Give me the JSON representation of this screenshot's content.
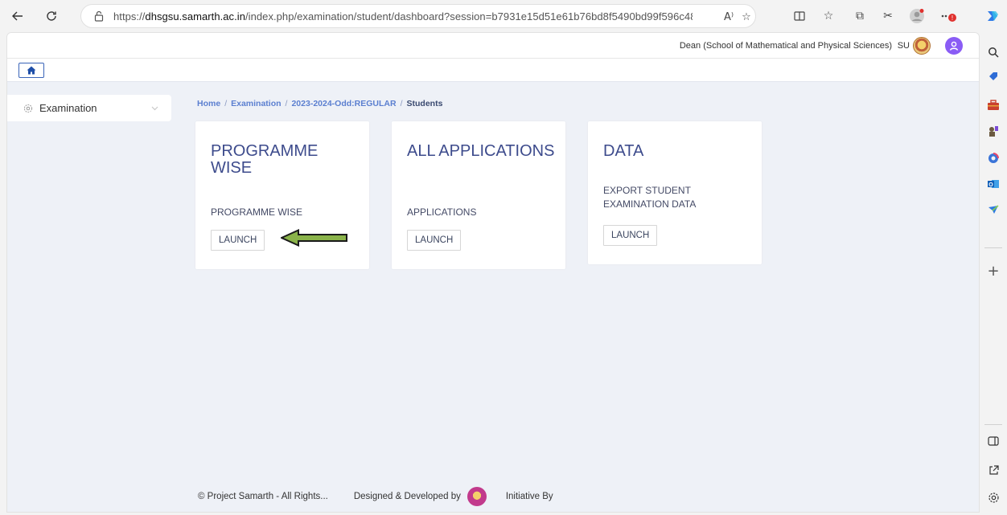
{
  "browser": {
    "url_prefix": "https://",
    "url_host": "dhsgsu.samarth.ac.in",
    "url_rest": "/index.php/examination/student/dashboard?session=b7931e15d51e61b76bd8f5490bd99f596c48b1ae..."
  },
  "header": {
    "role_text": "Dean (School of Mathematical and Physical Sciences)",
    "user_initials": "SU"
  },
  "sidebar": {
    "items": [
      {
        "label": "Examination"
      }
    ]
  },
  "breadcrumb": {
    "items": [
      "Home",
      "Examination",
      "2023-2024-Odd:REGULAR"
    ],
    "current": "Students"
  },
  "cards": [
    {
      "title": "PROGRAMME WISE",
      "subtitle": "PROGRAMME WISE",
      "button": "LAUNCH"
    },
    {
      "title": "ALL APPLICATIONS",
      "subtitle": "APPLICATIONS",
      "button": "LAUNCH"
    },
    {
      "title": "DATA",
      "subtitle": "EXPORT STUDENT EXAMINATION DATA",
      "button": "LAUNCH"
    }
  ],
  "footer": {
    "copyright": "© Project Samarth - All Rights...",
    "designed_by": "Designed & Developed by",
    "initiative": "Initiative By"
  },
  "colors": {
    "card_title": "#3d4b8c",
    "breadcrumb_link": "#5b7fd0",
    "arrow_fill": "#8ab34a",
    "avatar": "#8a5cf5"
  },
  "icons": {
    "back": "arrow-left-icon",
    "refresh": "refresh-icon",
    "home": "home-icon",
    "sidebar_examination": "gear-icon"
  }
}
